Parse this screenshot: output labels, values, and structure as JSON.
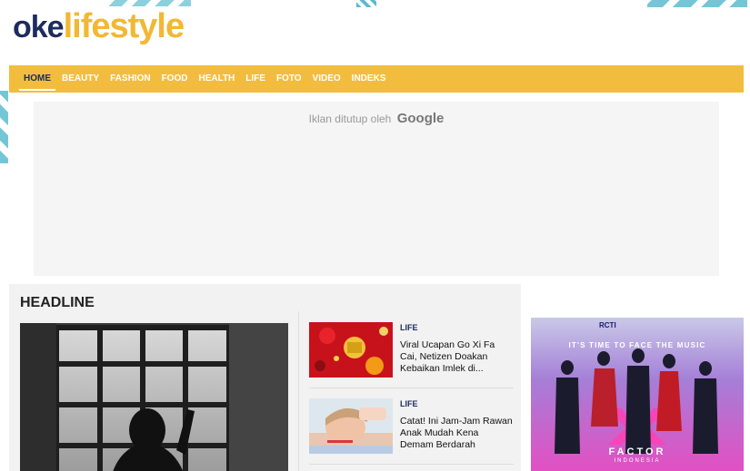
{
  "logo": {
    "part1": "oke",
    "part2": "lifestyle"
  },
  "nav": [
    {
      "label": "HOME",
      "active": true
    },
    {
      "label": "BEAUTY",
      "active": false
    },
    {
      "label": "FASHION",
      "active": false
    },
    {
      "label": "FOOD",
      "active": false
    },
    {
      "label": "HEALTH",
      "active": false
    },
    {
      "label": "LIFE",
      "active": false
    },
    {
      "label": "FOTO",
      "active": false
    },
    {
      "label": "VIDEO",
      "active": false
    },
    {
      "label": "INDEKS",
      "active": false
    }
  ],
  "ad": {
    "text": "Iklan ditutup oleh",
    "brand": "Google"
  },
  "headline": {
    "heading": "HEADLINE",
    "items": [
      {
        "category": "LIFE",
        "title": "Viral Ucapan Go Xi Fa Cai, Netizen Doakan Kebaikan Imlek di..."
      },
      {
        "category": "LIFE",
        "title": "Catat! Ini Jam-Jam Rawan Anak Mudah Kena Demam Berdarah"
      }
    ]
  },
  "banner": {
    "network": "RCTI",
    "tagline": "IT'S TIME TO FACE THE MUSIC",
    "show": "FACTOR",
    "country": "INDONESIA"
  },
  "colors": {
    "brand_navy": "#1d2b5f",
    "brand_yellow": "#f2bd3f",
    "accent_teal": "#5bbcd0"
  }
}
